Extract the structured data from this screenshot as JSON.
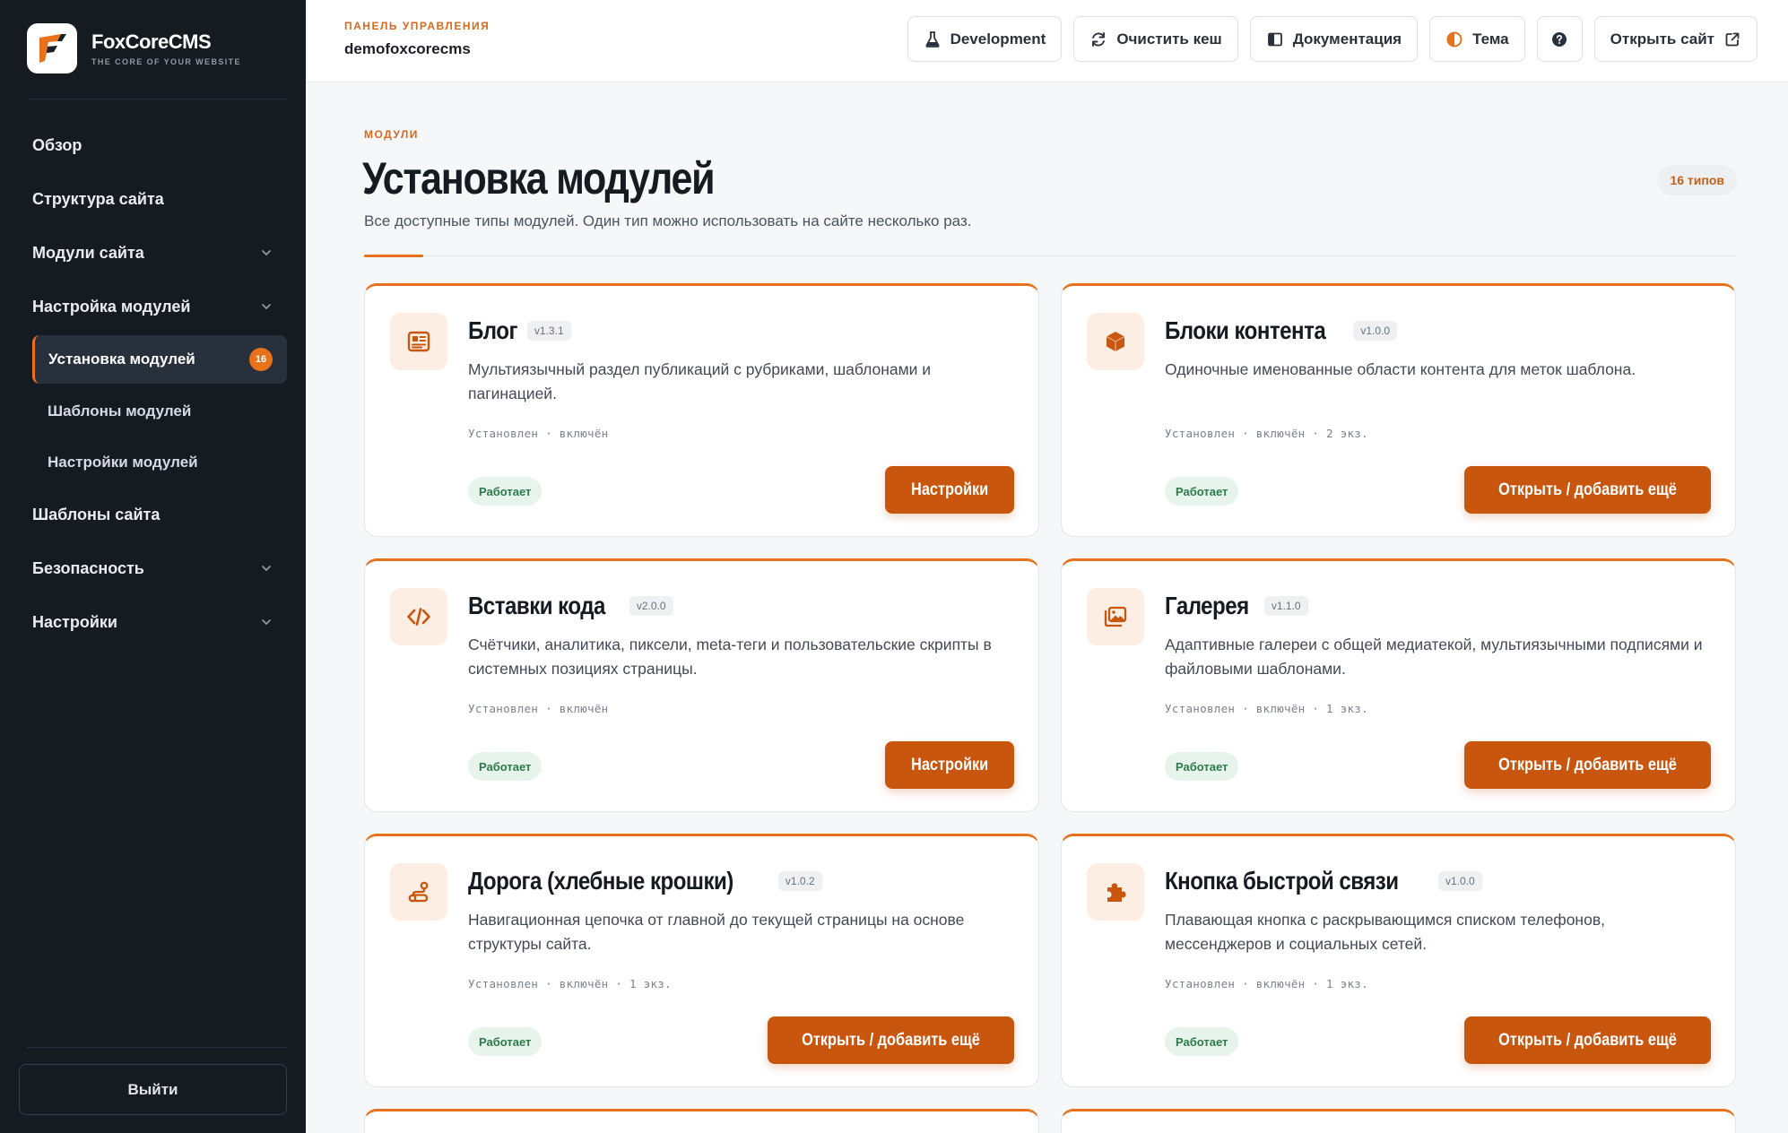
{
  "brand": {
    "name": "FoxCoreCMS",
    "tagline": "THE CORE OF YOUR WEBSITE"
  },
  "nav": {
    "overview": "Обзор",
    "structure": "Структура сайта",
    "site_modules": "Модули сайта",
    "module_settings": "Настройка модулей",
    "sub": {
      "install": "Установка модулей",
      "install_count": "16",
      "templates": "Шаблоны модулей",
      "settings": "Настройки модулей"
    },
    "site_templates": "Шаблоны сайта",
    "security": "Безопасность",
    "settings": "Настройки"
  },
  "logout": "Выйти",
  "topbar": {
    "eyebrow": "ПАНЕЛЬ УПРАВЛЕНИЯ",
    "site": "demofoxcorecms",
    "buttons": {
      "development": "Development",
      "clear_cache": "Очистить кеш",
      "docs": "Документация",
      "theme": "Тема",
      "open_site": "Открыть сайт"
    }
  },
  "page": {
    "eyebrow": "МОДУЛИ",
    "title": "Установка модулей",
    "subtitle": "Все доступные типы модулей. Один тип можно использовать на сайте несколько раз.",
    "types_count": "16 типов"
  },
  "colors": {
    "accent": "#e8711c",
    "button": "#c9560f",
    "sidebar": "#161b22",
    "status_ok": "#2c7a4b"
  },
  "modules": [
    {
      "icon": "newspaper-icon",
      "title": "Блог",
      "version": "v1.3.1",
      "description": "Мультиязычный раздел публикаций с рубриками, шаблонами и пагинацией.",
      "meta": "Установлен · включён",
      "status": "Работает",
      "action": "Настройки"
    },
    {
      "icon": "cube-icon",
      "title": "Блоки контента",
      "version": "v1.0.0",
      "description": "Одиночные именованные области контента для меток шаблона.",
      "meta": "Установлен · включён · 2 экз.",
      "status": "Работает",
      "action": "Открыть / добавить ещё"
    },
    {
      "icon": "code-icon",
      "title": "Вставки кода",
      "version": "v2.0.0",
      "description": "Счётчики, аналитика, пиксели, meta-теги и пользовательские скрипты в системных позициях страницы.",
      "meta": "Установлен · включён",
      "status": "Работает",
      "action": "Настройки"
    },
    {
      "icon": "gallery-icon",
      "title": "Галерея",
      "version": "v1.1.0",
      "description": "Адаптивные галереи с общей медиатекой, мультиязычными подписями и файловыми шаблонами.",
      "meta": "Установлен · включён · 1 экз.",
      "status": "Работает",
      "action": "Открыть / добавить ещё"
    },
    {
      "icon": "route-icon",
      "title": "Дорога (хлебные крошки)",
      "version": "v1.0.2",
      "description": "Навигационная цепочка от главной до текущей страницы на основе структуры сайта.",
      "meta": "Установлен · включён · 1 экз.",
      "status": "Работает",
      "action": "Открыть / добавить ещё"
    },
    {
      "icon": "puzzle-icon",
      "title": "Кнопка быстрой связи",
      "version": "v1.0.0",
      "description": "Плавающая кнопка с раскрывающимся списком телефонов, мессенджеров и социальных сетей.",
      "meta": "Установлен · включён · 1 экз.",
      "status": "Работает",
      "action": "Открыть / добавить ещё"
    }
  ]
}
